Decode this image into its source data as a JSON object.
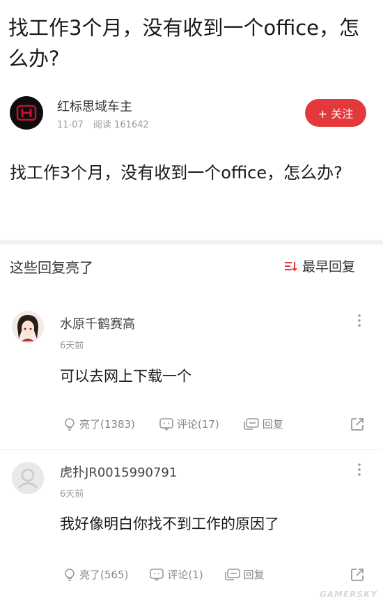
{
  "question": {
    "title": "找工作3个月，没有收到一个office，怎么办?",
    "body": "找工作3个月，没有收到一个office，怎么办?"
  },
  "author": {
    "name": "红标思域车主",
    "date": "11-07",
    "views": "阅读 161642",
    "follow_label": "+ 关注",
    "accent": "#e4393c"
  },
  "replies_section": {
    "title": "这些回复亮了",
    "sort_label": "最早回复"
  },
  "comments": [
    {
      "user": "水原千鹤赛高",
      "time": "6天前",
      "text": "可以去网上下载一个",
      "like_label": "亮了(1383)",
      "comment_label": "评论(17)",
      "reply_label": "回复"
    },
    {
      "user": "虎扑JR0015990791",
      "time": "6天前",
      "text": "我好像明白你找不到工作的原因了",
      "like_label": "亮了(565)",
      "comment_label": "评论(1)",
      "reply_label": "回复"
    }
  ],
  "watermark": "GAMERSKY"
}
